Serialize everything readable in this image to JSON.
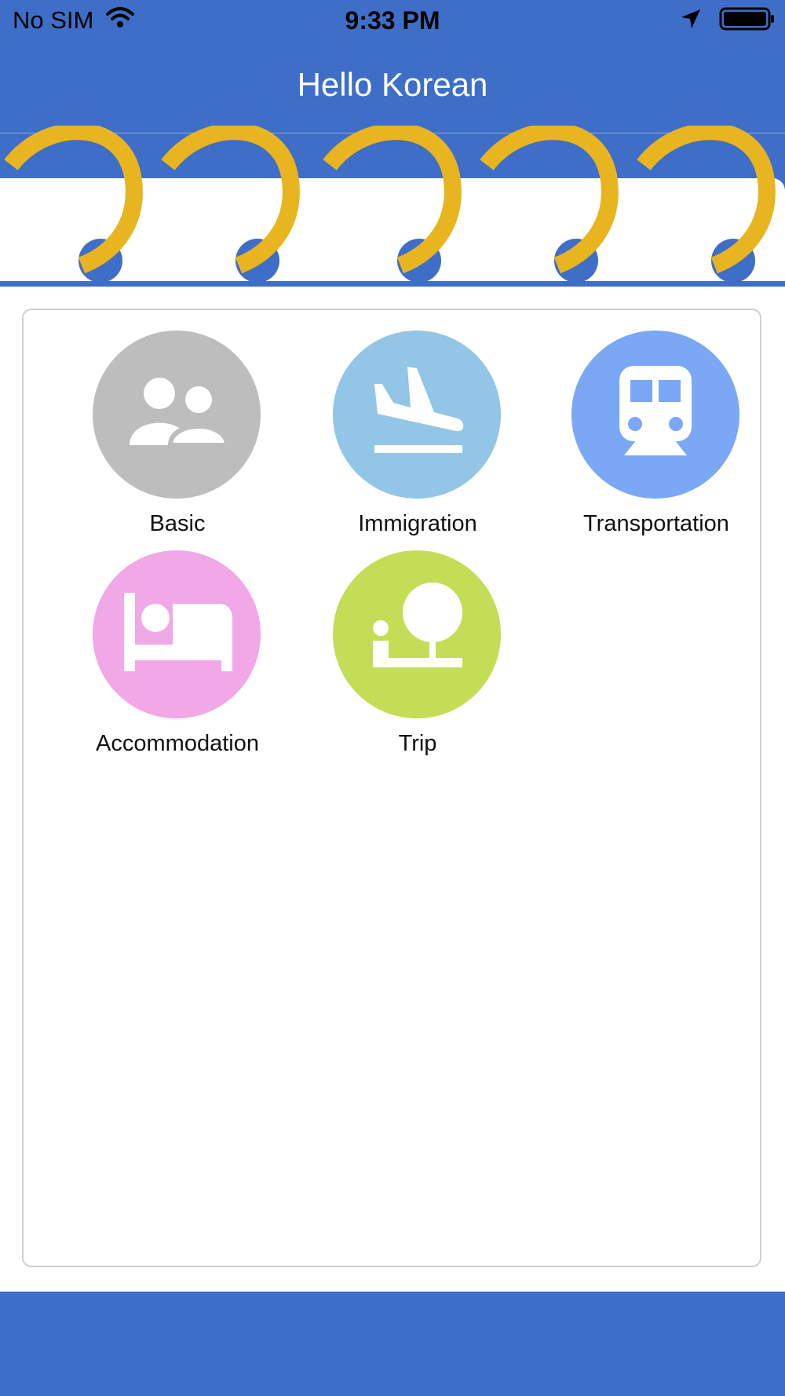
{
  "status_bar": {
    "carrier": "No SIM",
    "time": "9:33 PM",
    "icons": [
      "wifi-icon",
      "location-arrow-icon",
      "battery-icon"
    ]
  },
  "header": {
    "title": "Hello Korean"
  },
  "categories": [
    {
      "label": "Basic",
      "icon": "people-icon",
      "color": "#bdbdbd"
    },
    {
      "label": "Immigration",
      "icon": "plane-arrival-icon",
      "color": "#93c5e6"
    },
    {
      "label": "Transportation",
      "icon": "train-icon",
      "color": "#7aa8f5"
    },
    {
      "label": "Accommodation",
      "icon": "bed-icon",
      "color": "#f0a8e6"
    },
    {
      "label": "Trip",
      "icon": "park-icon",
      "color": "#c4dd57"
    }
  ],
  "colors": {
    "primary": "#3e6ec7",
    "ring": "#e8b420"
  }
}
